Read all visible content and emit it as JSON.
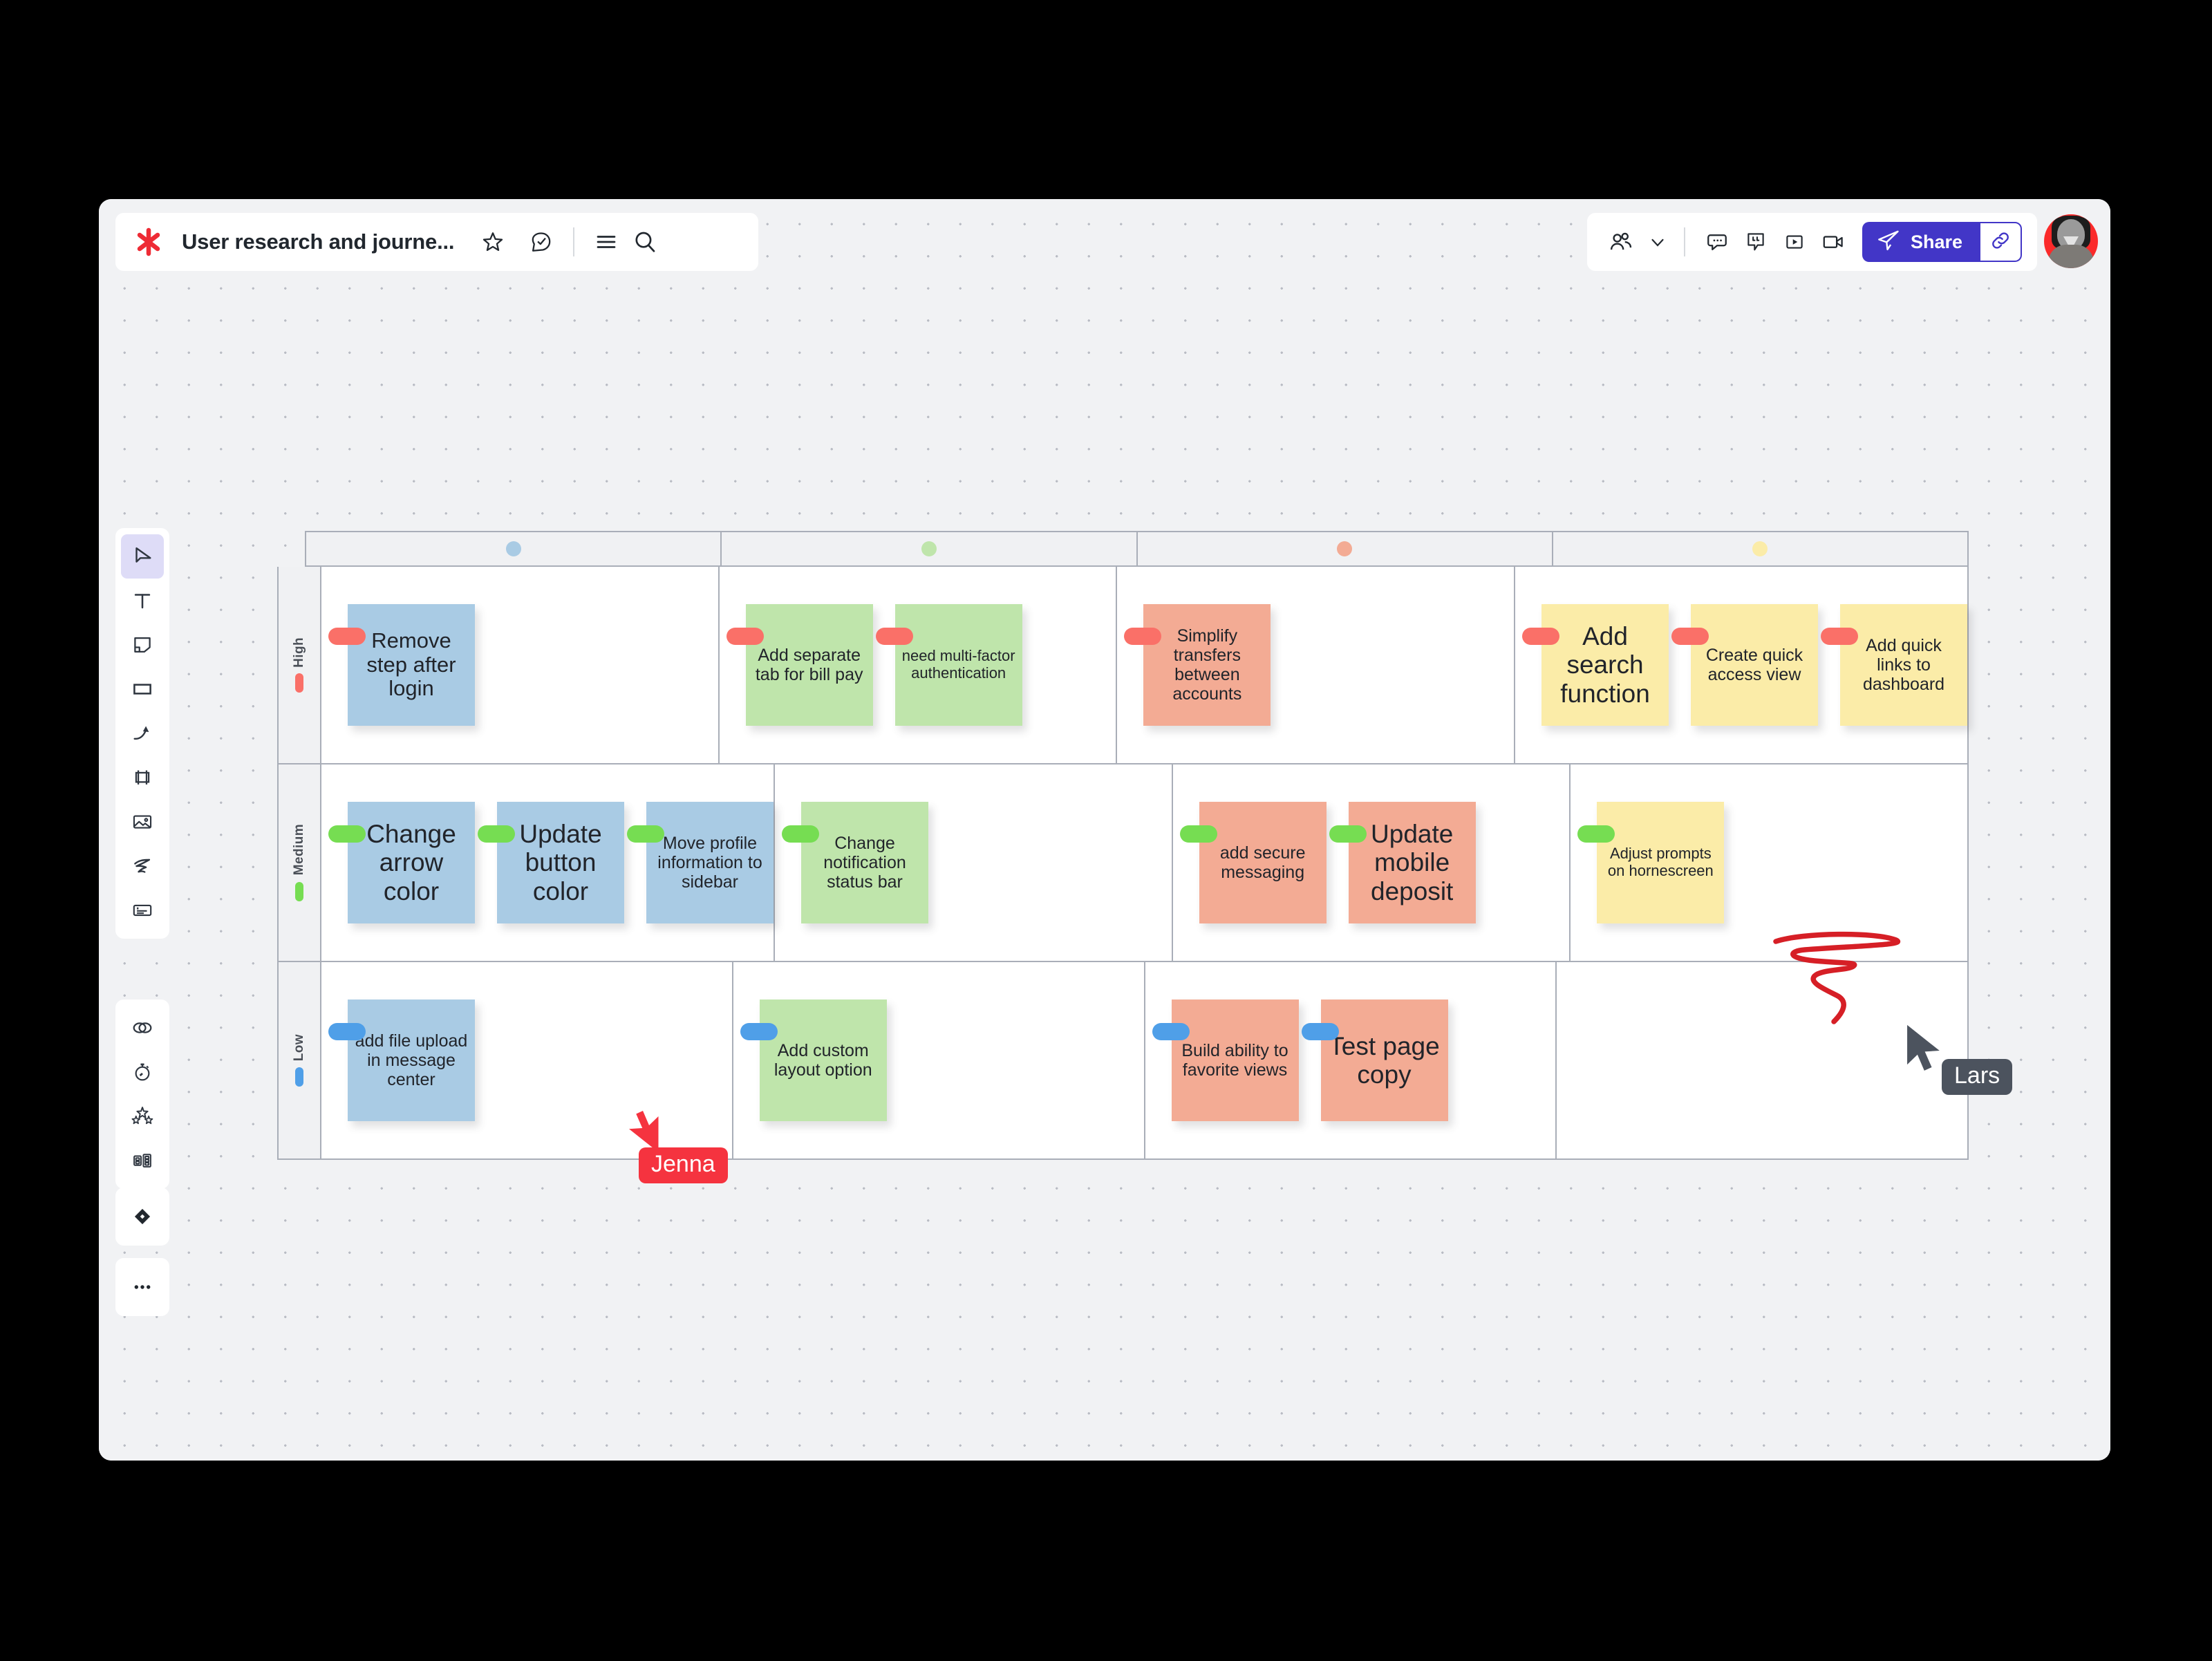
{
  "app": {
    "board_title": "User research and journe...",
    "logo_icon": "mural-asterisk-logo"
  },
  "topbar_left": {
    "star_icon": "star-icon",
    "approve_icon": "approve-check-icon",
    "menu_icon": "hamburger-menu-icon",
    "search_icon": "search-icon"
  },
  "topbar_right": {
    "people_icon": "people-group-icon",
    "chevron_icon": "chevron-down-icon",
    "chat_icon": "chat-bubble-icon",
    "quote_icon": "quote-bubble-icon",
    "play_icon": "play-box-icon",
    "video_icon": "video-camera-icon",
    "share_label": "Share",
    "share_send_icon": "paper-plane-icon",
    "share_link_icon": "link-chain-icon",
    "avatar_label": "user-avatar"
  },
  "toolbar": {
    "groups": [
      {
        "items": [
          {
            "name": "select-tool",
            "icon": "cursor-arrow-icon",
            "active": true
          },
          {
            "name": "text-tool",
            "icon": "text-t-icon",
            "active": false
          },
          {
            "name": "sticky-note-tool",
            "icon": "sticky-note-icon",
            "active": false
          },
          {
            "name": "shape-tool",
            "icon": "rectangle-icon",
            "active": false
          },
          {
            "name": "connector-tool",
            "icon": "curved-arrow-icon",
            "active": false
          },
          {
            "name": "frame-tool",
            "icon": "frame-icon",
            "active": false
          },
          {
            "name": "image-tool",
            "icon": "image-icon",
            "active": false
          },
          {
            "name": "draw-tool",
            "icon": "scribble-pen-icon",
            "active": false
          },
          {
            "name": "comment-tool",
            "icon": "card-lines-icon",
            "active": false
          }
        ]
      },
      {
        "items": [
          {
            "name": "venn-diagram-tool",
            "icon": "venn-circles-icon",
            "active": false
          },
          {
            "name": "timer-tool",
            "icon": "stopwatch-icon",
            "active": false
          },
          {
            "name": "voting-tool",
            "icon": "three-stars-icon",
            "active": false
          },
          {
            "name": "private-mode-tool",
            "icon": "two-cards-icon",
            "active": false
          }
        ]
      },
      {
        "items": [
          {
            "name": "templates-tool",
            "icon": "diamond-icon",
            "active": false
          }
        ]
      },
      {
        "items": [
          {
            "name": "more-tools",
            "icon": "ellipsis-icon",
            "active": false
          }
        ]
      }
    ]
  },
  "board": {
    "columns": [
      {
        "label": "",
        "dot_color": "#a9cbe4",
        "name": "column-blue"
      },
      {
        "label": "",
        "dot_color": "#bfe5ab",
        "name": "column-green"
      },
      {
        "label": "",
        "dot_color": "#f3ab94",
        "name": "column-red"
      },
      {
        "label": "",
        "dot_color": "#fbeca8",
        "name": "column-yellow"
      }
    ],
    "rows": [
      {
        "label": "High",
        "dot_color": "#fa7068",
        "tag_color": "tag-red",
        "cells": [
          [
            {
              "text": "Remove step after login",
              "color": "blue",
              "size": "fs-22"
            }
          ],
          [
            {
              "text": "Add separate tab for bill pay",
              "color": "green",
              "size": "fs-18"
            },
            {
              "text": "need multi-factor authentication",
              "color": "green",
              "size": "fs-15"
            }
          ],
          [
            {
              "text": "Simplify transfers between accounts",
              "color": "red",
              "size": "fs-18"
            }
          ],
          [
            {
              "text": "Add search function",
              "color": "yellow",
              "size": "fs-26"
            },
            {
              "text": "Create quick access view",
              "color": "yellow",
              "size": "fs-18"
            },
            {
              "text": "Add quick links to dashboard",
              "color": "yellow",
              "size": "fs-18"
            }
          ]
        ]
      },
      {
        "label": "Medium",
        "dot_color": "#76dd52",
        "tag_color": "tag-green",
        "cells": [
          [
            {
              "text": "Change arrow color",
              "color": "blue",
              "size": "fs-26"
            },
            {
              "text": "Update button color",
              "color": "blue",
              "size": "fs-26"
            },
            {
              "text": "Move profile information to sidebar",
              "color": "blue",
              "size": "fs-18"
            }
          ],
          [
            {
              "text": "Change notification status bar",
              "color": "green",
              "size": "fs-18"
            }
          ],
          [
            {
              "text": "add secure messaging",
              "color": "red",
              "size": "fs-18"
            },
            {
              "text": "Update mobile deposit",
              "color": "red",
              "size": "fs-26"
            }
          ],
          [
            {
              "text": "Adjust prompts on hornescreen",
              "color": "yellow",
              "size": "fs-15"
            }
          ]
        ]
      },
      {
        "label": "Low",
        "dot_color": "#4f9fe8",
        "tag_color": "tag-blue",
        "cells": [
          [
            {
              "text": "add file upload in message center",
              "color": "blue",
              "size": "fs-18"
            }
          ],
          [
            {
              "text": "Add custom layout option",
              "color": "green",
              "size": "fs-18"
            }
          ],
          [
            {
              "text": "Build ability to favorite views",
              "color": "red",
              "size": "fs-18"
            },
            {
              "text": "Test page copy",
              "color": "red",
              "size": "fs-26"
            }
          ],
          []
        ]
      }
    ]
  },
  "collaborators": [
    {
      "name": "Lars",
      "label_color": "#4c535e",
      "cursor_color": "#4c535e"
    },
    {
      "name": "Jenna",
      "label_color": "#f5333f",
      "cursor_color": "#f5333f"
    }
  ],
  "annotations": {
    "scribble_color": "#d61f26",
    "scribble_name": "red-ink-scribble"
  }
}
